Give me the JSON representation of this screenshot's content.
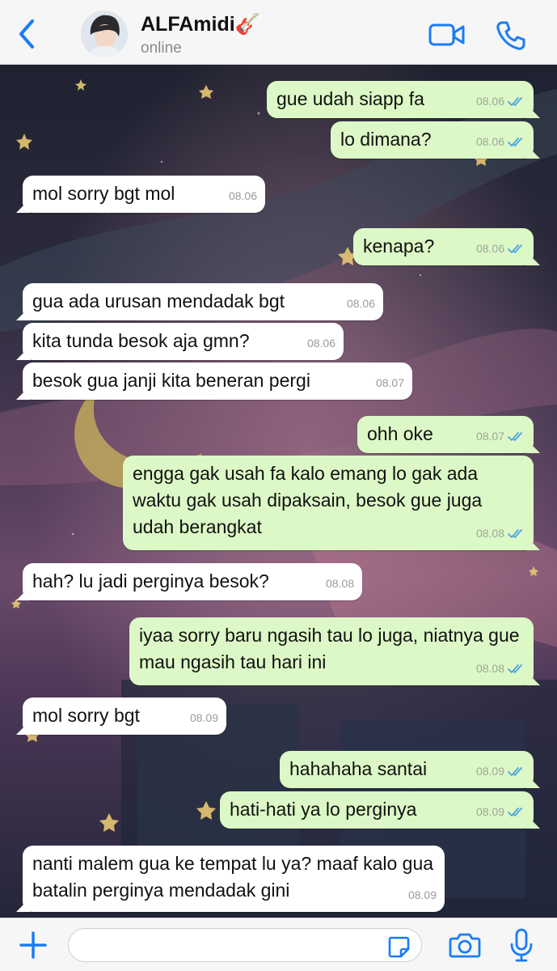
{
  "header": {
    "name": "ALFAmidi🎸",
    "status": "online",
    "accent_color": "#1a7cf5",
    "icons": [
      "chevron-left-icon",
      "avatar",
      "video-call-icon",
      "phone-call-icon"
    ]
  },
  "messages": [
    {
      "dir": "out",
      "text": "gue udah siapp fa",
      "time": "08.06"
    },
    {
      "dir": "out",
      "text": "lo dimana?",
      "time": "08.06"
    },
    {
      "dir": "in",
      "text": "mol sorry bgt mol",
      "time": "08.06"
    },
    {
      "dir": "out",
      "text": "kenapa?",
      "time": "08.06"
    },
    {
      "dir": "in",
      "text": "gua ada urusan mendadak bgt",
      "time": "08.06"
    },
    {
      "dir": "in",
      "text": "kita tunda besok aja gmn?",
      "time": "08.06"
    },
    {
      "dir": "in",
      "text": "besok gua janji kita beneran pergi",
      "time": "08.07"
    },
    {
      "dir": "out",
      "text": "ohh oke",
      "time": "08.07"
    },
    {
      "dir": "out",
      "text": "engga gak usah fa kalo emang lo gak ada waktu gak usah dipaksain, besok gue juga udah berangkat",
      "time": "08.08"
    },
    {
      "dir": "in",
      "text": "hah? lu jadi perginya besok?",
      "time": "08.08"
    },
    {
      "dir": "out",
      "text": "iyaa sorry baru ngasih tau lo juga, niatnya gue mau ngasih tau hari ini",
      "time": "08.08"
    },
    {
      "dir": "in",
      "text": "mol sorry bgt",
      "time": "08.09"
    },
    {
      "dir": "out",
      "text": "hahahaha santai",
      "time": "08.09"
    },
    {
      "dir": "out",
      "text": "hati-hati ya lo perginya",
      "time": "08.09"
    },
    {
      "dir": "in",
      "text": "nanti malem gua ke tempat lu ya? maaf kalo gua batalin perginya mendadak gini",
      "time": "08.09"
    }
  ],
  "input": {
    "value": "",
    "placeholder": "",
    "icons": [
      "plus-icon",
      "sticker-icon",
      "camera-icon",
      "microphone-icon"
    ]
  },
  "colors": {
    "incoming_bubble": "#ffffff",
    "outgoing_bubble": "#dcf8c6",
    "read_tick": "#4fa3e0"
  }
}
